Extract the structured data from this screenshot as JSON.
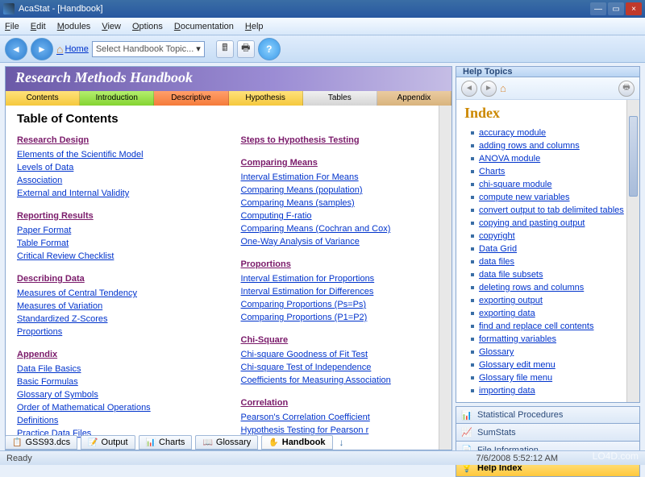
{
  "window": {
    "title": "AcaStat - [Handbook]"
  },
  "menu": [
    "File",
    "Edit",
    "Modules",
    "View",
    "Options",
    "Documentation",
    "Help"
  ],
  "toolbar": {
    "home": "Home",
    "dropdown": "Select Handbook Topic..."
  },
  "banner": {
    "title": "Research Methods Handbook"
  },
  "tabs": [
    "Contents",
    "Introduction",
    "Descriptive",
    "Hypothesis",
    "Tables",
    "Appendix"
  ],
  "content": {
    "heading": "Table of Contents",
    "left": [
      {
        "hdr": "Research Design",
        "items": [
          "Elements of the Scientific Model",
          "Levels of Data",
          "Association",
          "External and Internal Validity"
        ]
      },
      {
        "hdr": "Reporting Results",
        "items": [
          "Paper Format",
          "Table Format",
          "Critical Review Checklist"
        ]
      },
      {
        "hdr": "Describing Data",
        "items": [
          "Measures of Central Tendency",
          "Measures of Variation",
          "Standardized Z-Scores",
          "Proportions"
        ]
      },
      {
        "hdr": "Appendix",
        "items": [
          "Data File Basics",
          "Basic Formulas",
          "Glossary of Symbols",
          "Order of Mathematical Operations",
          "Definitions",
          "Practice Data Files"
        ]
      }
    ],
    "right": [
      {
        "hdr": "Steps to Hypothesis Testing",
        "items": []
      },
      {
        "hdr": "Comparing Means",
        "items": [
          "Interval Estimation For Means",
          "Comparing Means (population)",
          "Comparing Means (samples)",
          "Computing F-ratio",
          "Comparing Means (Cochran and Cox)",
          "One-Way Analysis of Variance"
        ]
      },
      {
        "hdr": "Proportions",
        "items": [
          "Interval Estimation for Proportions",
          "Interval Estimation for Differences",
          "Comparing Proportions (Ps=Ps)",
          "Comparing Proportions (P1=P2)"
        ]
      },
      {
        "hdr": "Chi-Square",
        "items": [
          "Chi-square Goodness of Fit Test",
          "Chi-square Test of Independence",
          "Coefficients for Measuring Association"
        ]
      },
      {
        "hdr": "Correlation",
        "items": [
          "Pearson's Correlation Coefficient",
          "Hypothesis Testing for Pearson r"
        ]
      }
    ]
  },
  "helpPanel": {
    "header": "Help Topics",
    "indexTitle": "Index",
    "items": [
      "accuracy module",
      "adding rows and columns",
      "ANOVA module",
      "Charts",
      "chi-square module",
      "compute new variables",
      "convert output to tab delimited tables",
      "copying and pasting output",
      "copyright",
      "Data Grid",
      "data files",
      "data file subsets",
      "deleting rows and columns",
      "exporting output",
      "exporting data",
      "find and replace cell contents",
      "formatting variables",
      "Glossary",
      "Glossary edit menu",
      "Glossary file menu",
      "importing data"
    ]
  },
  "stack": [
    {
      "label": "Statistical Procedures",
      "icon": "📊"
    },
    {
      "label": "SumStats",
      "icon": "📈"
    },
    {
      "label": "File Information",
      "icon": "📄"
    },
    {
      "label": "Help Index",
      "icon": "💡",
      "active": true
    }
  ],
  "bottomTabs": [
    {
      "label": "GSS93.dcs",
      "icon": "📋"
    },
    {
      "label": "Output",
      "icon": "📝"
    },
    {
      "label": "Charts",
      "icon": "📊"
    },
    {
      "label": "Glossary",
      "icon": "📖"
    },
    {
      "label": "Handbook",
      "icon": "✋",
      "active": true
    }
  ],
  "status": {
    "text": "Ready",
    "timestamp": "7/6/2008 5:52:12 AM"
  },
  "watermark": "LO4D.com"
}
